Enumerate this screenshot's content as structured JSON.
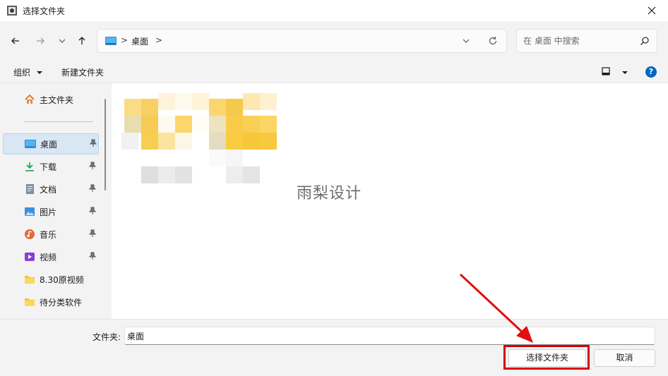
{
  "window": {
    "title": "选择文件夹",
    "close_glyph": "✕"
  },
  "nav": {
    "back_glyph": "←",
    "forward_glyph": "→",
    "recent_glyph": "⌄",
    "up_glyph": "↑"
  },
  "address": {
    "separator": ">",
    "crumb": "桌面",
    "trailing_separator": ">"
  },
  "search": {
    "placeholder": "在 桌面 中搜索"
  },
  "toolbar": {
    "organize_label": "组织",
    "new_folder_label": "新建文件夹",
    "help_glyph": "?"
  },
  "sidebar": {
    "items": [
      {
        "label": "主文件夹",
        "icon": "home-icon",
        "pinned": false
      },
      {
        "label": "桌面",
        "icon": "desktop-icon",
        "pinned": true,
        "selected": true
      },
      {
        "label": "下载",
        "icon": "download-icon",
        "pinned": true
      },
      {
        "label": "文档",
        "icon": "document-icon",
        "pinned": true
      },
      {
        "label": "图片",
        "icon": "pictures-icon",
        "pinned": true
      },
      {
        "label": "音乐",
        "icon": "music-icon",
        "pinned": true
      },
      {
        "label": "视频",
        "icon": "video-icon",
        "pinned": true
      },
      {
        "label": "8.30原视频",
        "icon": "folder-icon",
        "pinned": false
      },
      {
        "label": "待分类软件",
        "icon": "folder-icon",
        "pinned": false
      }
    ]
  },
  "content": {
    "watermark": "雨梨设计"
  },
  "footer": {
    "folder_label": "文件夹:",
    "folder_value": "桌面",
    "select_button": "选择文件夹",
    "cancel_button": "取消"
  },
  "colors": {
    "accent": "#0067c0",
    "annotation_red": "#d80000",
    "folder_yellow": "#f5c53a"
  }
}
